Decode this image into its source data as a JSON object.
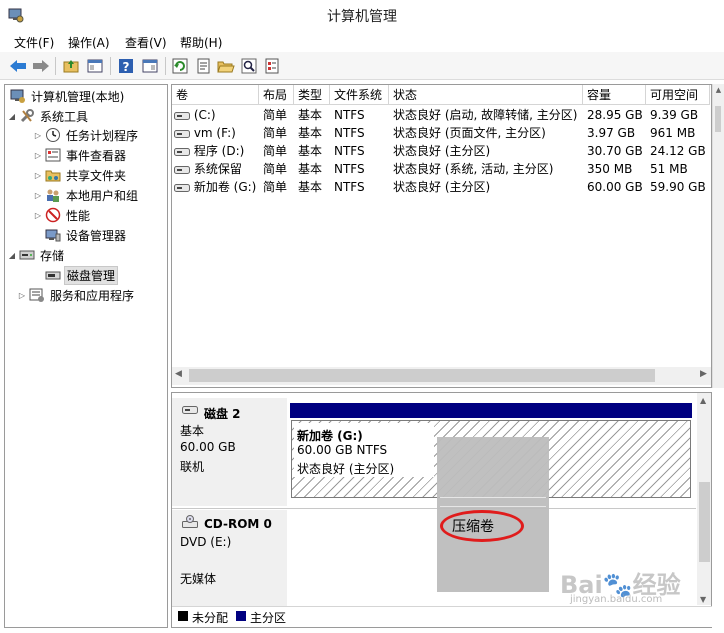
{
  "window": {
    "title": "计算机管理"
  },
  "menu": [
    "文件(F)",
    "操作(A)",
    "查看(V)",
    "帮助(H)"
  ],
  "tree": {
    "root": "计算机管理(本地)",
    "system_tools": "系统工具",
    "task_scheduler": "任务计划程序",
    "event_viewer": "事件查看器",
    "shared_folders": "共享文件夹",
    "local_users": "本地用户和组",
    "performance": "性能",
    "device_manager": "设备管理器",
    "storage": "存储",
    "disk_management": "磁盘管理",
    "services": "服务和应用程序"
  },
  "columns": [
    "卷",
    "布局",
    "类型",
    "文件系统",
    "状态",
    "容量",
    "可用空间"
  ],
  "volumes": [
    {
      "vol": "(C:)",
      "layout": "简单",
      "type": "基本",
      "fs": "NTFS",
      "status": "状态良好 (启动, 故障转储, 主分区)",
      "capacity": "28.95 GB",
      "free": "9.39 GB"
    },
    {
      "vol": "vm (F:)",
      "layout": "简单",
      "type": "基本",
      "fs": "NTFS",
      "status": "状态良好 (页面文件, 主分区)",
      "capacity": "3.97 GB",
      "free": "961 MB"
    },
    {
      "vol": "程序 (D:)",
      "layout": "简单",
      "type": "基本",
      "fs": "NTFS",
      "status": "状态良好 (主分区)",
      "capacity": "30.70 GB",
      "free": "24.12 GB"
    },
    {
      "vol": "系统保留",
      "layout": "简单",
      "type": "基本",
      "fs": "NTFS",
      "status": "状态良好 (系统, 活动, 主分区)",
      "capacity": "350 MB",
      "free": "51 MB"
    },
    {
      "vol": "新加卷 (G:)",
      "layout": "简单",
      "type": "基本",
      "fs": "NTFS",
      "status": "状态良好 (主分区)",
      "capacity": "60.00 GB",
      "free": "59.90 GB"
    }
  ],
  "disk2": {
    "name": "磁盘 2",
    "type": "基本",
    "size": "60.00 GB",
    "state": "联机",
    "partition_name": "新加卷  (G:)",
    "partition_size": "60.00 GB NTFS",
    "partition_status": "状态良好 (主分区)"
  },
  "cdrom": {
    "name": "CD-ROM 0",
    "drive": "DVD (E:)",
    "media": "无媒体"
  },
  "context_menu": {
    "highlighted_item": "压缩卷"
  },
  "legend": [
    {
      "label": "未分配",
      "color": "#000000"
    },
    {
      "label": "主分区",
      "color": "#000080"
    }
  ],
  "watermark": {
    "brand": "Bai",
    "brand2": "经验",
    "url": "jingyan.baidu.com"
  },
  "colors": {
    "primary_partition": "#000080",
    "highlight_circle": "#e01c1c"
  }
}
